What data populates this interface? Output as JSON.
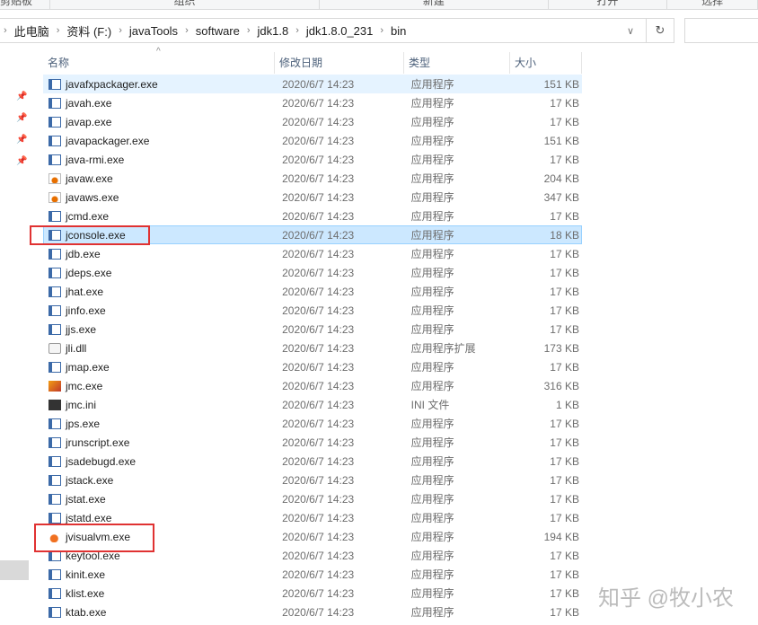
{
  "ribbon": [
    "剪贴板",
    "组织",
    "新建",
    "打开",
    "选择"
  ],
  "breadcrumb": [
    "此电脑",
    "资料 (F:)",
    "javaTools",
    "software",
    "jdk1.8",
    "jdk1.8.0_231",
    "bin"
  ],
  "columns": {
    "name": "名称",
    "date": "修改日期",
    "type": "类型",
    "size": "大小"
  },
  "files": [
    {
      "name": "javafxpackager.exe",
      "date": "2020/6/7 14:23",
      "type": "应用程序",
      "size": "151 KB",
      "icon": "exe"
    },
    {
      "name": "javah.exe",
      "date": "2020/6/7 14:23",
      "type": "应用程序",
      "size": "17 KB",
      "icon": "exe"
    },
    {
      "name": "javap.exe",
      "date": "2020/6/7 14:23",
      "type": "应用程序",
      "size": "17 KB",
      "icon": "exe"
    },
    {
      "name": "javapackager.exe",
      "date": "2020/6/7 14:23",
      "type": "应用程序",
      "size": "151 KB",
      "icon": "exe"
    },
    {
      "name": "java-rmi.exe",
      "date": "2020/6/7 14:23",
      "type": "应用程序",
      "size": "17 KB",
      "icon": "exe"
    },
    {
      "name": "javaw.exe",
      "date": "2020/6/7 14:23",
      "type": "应用程序",
      "size": "204 KB",
      "icon": "java"
    },
    {
      "name": "javaws.exe",
      "date": "2020/6/7 14:23",
      "type": "应用程序",
      "size": "347 KB",
      "icon": "java"
    },
    {
      "name": "jcmd.exe",
      "date": "2020/6/7 14:23",
      "type": "应用程序",
      "size": "17 KB",
      "icon": "exe"
    },
    {
      "name": "jconsole.exe",
      "date": "2020/6/7 14:23",
      "type": "应用程序",
      "size": "18 KB",
      "icon": "exe"
    },
    {
      "name": "jdb.exe",
      "date": "2020/6/7 14:23",
      "type": "应用程序",
      "size": "17 KB",
      "icon": "exe"
    },
    {
      "name": "jdeps.exe",
      "date": "2020/6/7 14:23",
      "type": "应用程序",
      "size": "17 KB",
      "icon": "exe"
    },
    {
      "name": "jhat.exe",
      "date": "2020/6/7 14:23",
      "type": "应用程序",
      "size": "17 KB",
      "icon": "exe"
    },
    {
      "name": "jinfo.exe",
      "date": "2020/6/7 14:23",
      "type": "应用程序",
      "size": "17 KB",
      "icon": "exe"
    },
    {
      "name": "jjs.exe",
      "date": "2020/6/7 14:23",
      "type": "应用程序",
      "size": "17 KB",
      "icon": "exe"
    },
    {
      "name": "jli.dll",
      "date": "2020/6/7 14:23",
      "type": "应用程序扩展",
      "size": "173 KB",
      "icon": "dll"
    },
    {
      "name": "jmap.exe",
      "date": "2020/6/7 14:23",
      "type": "应用程序",
      "size": "17 KB",
      "icon": "exe"
    },
    {
      "name": "jmc.exe",
      "date": "2020/6/7 14:23",
      "type": "应用程序",
      "size": "316 KB",
      "icon": "jmc"
    },
    {
      "name": "jmc.ini",
      "date": "2020/6/7 14:23",
      "type": "INI 文件",
      "size": "1 KB",
      "icon": "ini"
    },
    {
      "name": "jps.exe",
      "date": "2020/6/7 14:23",
      "type": "应用程序",
      "size": "17 KB",
      "icon": "exe"
    },
    {
      "name": "jrunscript.exe",
      "date": "2020/6/7 14:23",
      "type": "应用程序",
      "size": "17 KB",
      "icon": "exe"
    },
    {
      "name": "jsadebugd.exe",
      "date": "2020/6/7 14:23",
      "type": "应用程序",
      "size": "17 KB",
      "icon": "exe"
    },
    {
      "name": "jstack.exe",
      "date": "2020/6/7 14:23",
      "type": "应用程序",
      "size": "17 KB",
      "icon": "exe"
    },
    {
      "name": "jstat.exe",
      "date": "2020/6/7 14:23",
      "type": "应用程序",
      "size": "17 KB",
      "icon": "exe"
    },
    {
      "name": "jstatd.exe",
      "date": "2020/6/7 14:23",
      "type": "应用程序",
      "size": "17 KB",
      "icon": "exe"
    },
    {
      "name": "jvisualvm.exe",
      "date": "2020/6/7 14:23",
      "type": "应用程序",
      "size": "194 KB",
      "icon": "vvm"
    },
    {
      "name": "keytool.exe",
      "date": "2020/6/7 14:23",
      "type": "应用程序",
      "size": "17 KB",
      "icon": "exe"
    },
    {
      "name": "kinit.exe",
      "date": "2020/6/7 14:23",
      "type": "应用程序",
      "size": "17 KB",
      "icon": "exe"
    },
    {
      "name": "klist.exe",
      "date": "2020/6/7 14:23",
      "type": "应用程序",
      "size": "17 KB",
      "icon": "exe"
    },
    {
      "name": "ktab.exe",
      "date": "2020/6/7 14:23",
      "type": "应用程序",
      "size": "17 KB",
      "icon": "exe"
    }
  ],
  "watermark": "知乎 @牧小农",
  "colors": {
    "highlight": "#e03232",
    "selected": "#cce8ff"
  }
}
